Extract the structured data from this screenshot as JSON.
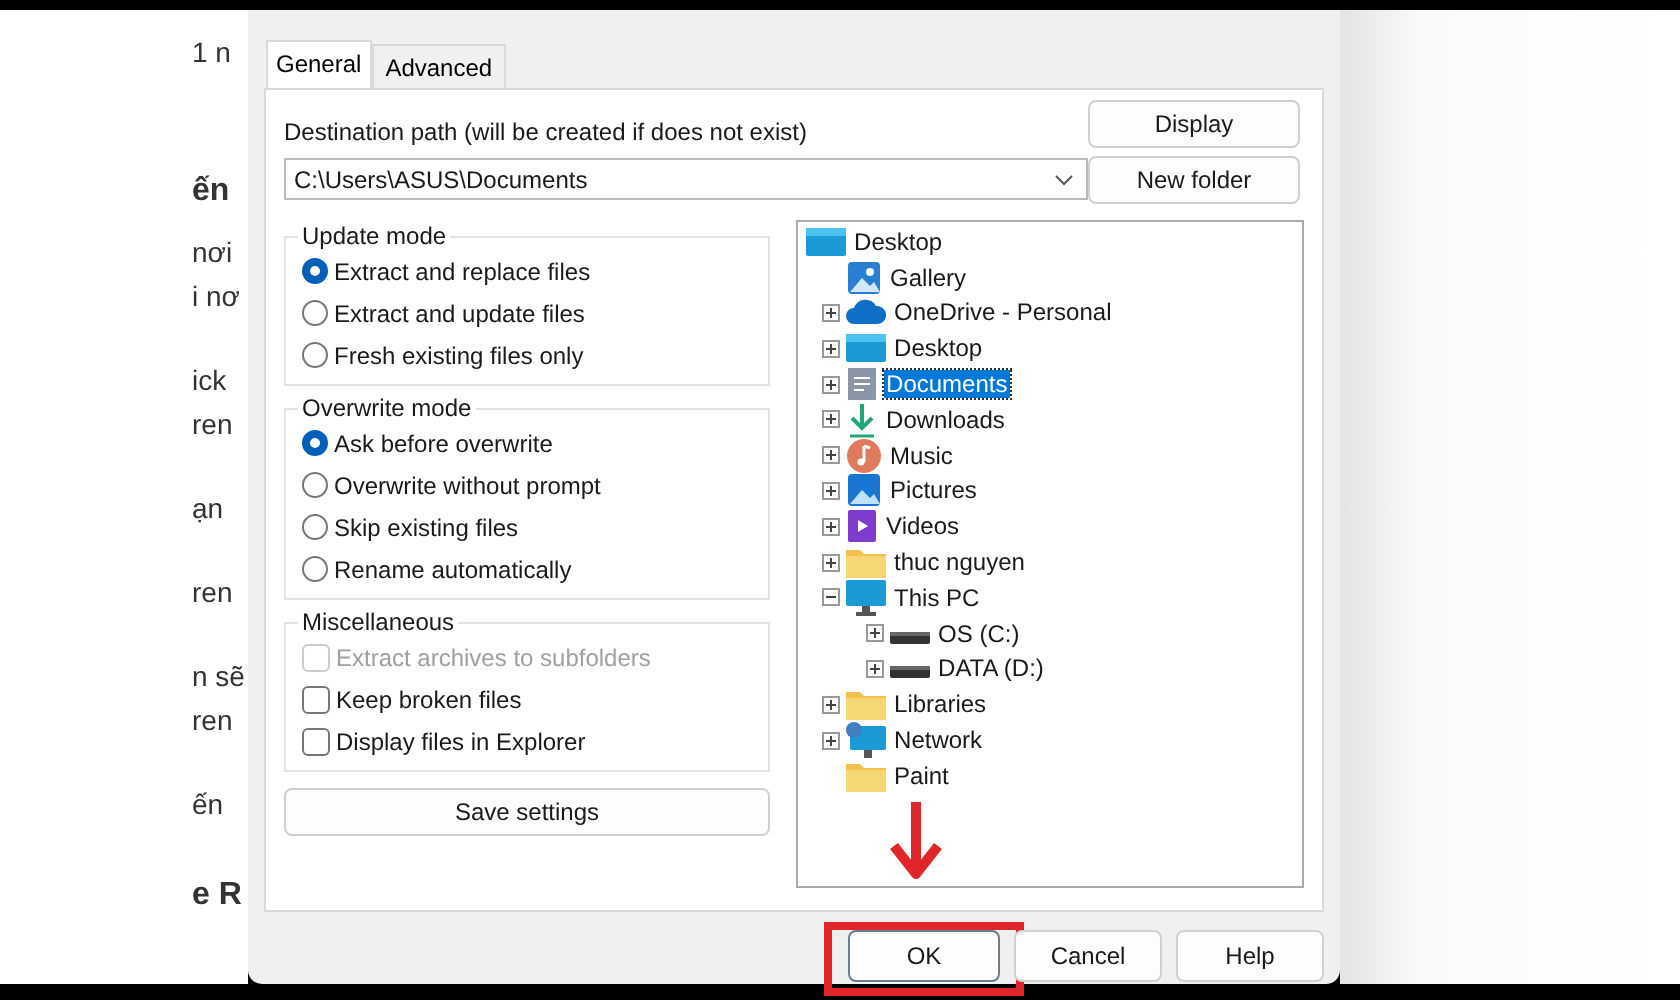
{
  "background_page": {
    "lines": [
      {
        "text": "1 n",
        "kind": "body"
      },
      {
        "text": "ến",
        "kind": "heading"
      },
      {
        "text": "nơi",
        "kind": "body"
      },
      {
        "text": "i nơ",
        "kind": "body"
      },
      {
        "text": "ick",
        "kind": "body"
      },
      {
        "text": "ren",
        "kind": "body"
      },
      {
        "text": "ạn",
        "kind": "body"
      },
      {
        "text": "ren",
        "kind": "body"
      },
      {
        "text": "n sẽ",
        "kind": "body"
      },
      {
        "text": "ren",
        "kind": "body"
      },
      {
        "text": "ến",
        "kind": "body"
      },
      {
        "text": "e R",
        "kind": "heading"
      }
    ]
  },
  "dialog": {
    "tabs": [
      {
        "label": "General",
        "selected": true
      },
      {
        "label": "Advanced",
        "selected": false
      }
    ],
    "destination": {
      "label": "Destination path (will be created if does not exist)",
      "value": "C:\\Users\\ASUS\\Documents"
    },
    "side_buttons": [
      "Display",
      "New folder"
    ],
    "update_mode": {
      "title": "Update mode",
      "options": [
        {
          "label": "Extract and replace files",
          "selected": true
        },
        {
          "label": "Extract and update files",
          "selected": false
        },
        {
          "label": "Fresh existing files only",
          "selected": false
        }
      ]
    },
    "overwrite_mode": {
      "title": "Overwrite mode",
      "options": [
        {
          "label": "Ask before overwrite",
          "selected": true
        },
        {
          "label": "Overwrite without prompt",
          "selected": false
        },
        {
          "label": "Skip existing files",
          "selected": false
        },
        {
          "label": "Rename automatically",
          "selected": false
        }
      ]
    },
    "miscellaneous": {
      "title": "Miscellaneous",
      "options": [
        {
          "label": "Extract archives to subfolders",
          "checked": false,
          "disabled": true
        },
        {
          "label": "Keep broken files",
          "checked": false,
          "disabled": false
        },
        {
          "label": "Display files in Explorer",
          "checked": false,
          "disabled": false
        }
      ]
    },
    "save_button": "Save settings",
    "tree": [
      {
        "label": "Desktop",
        "kind": "desktop",
        "selected": false,
        "children": [
          {
            "label": "Gallery",
            "kind": "gallery",
            "selected": false
          },
          {
            "label": "OneDrive - Personal",
            "kind": "cloud",
            "selected": false,
            "expanded": false
          },
          {
            "label": "Desktop",
            "kind": "desktop",
            "selected": false,
            "expanded": false
          },
          {
            "label": "Documents",
            "kind": "document",
            "selected": true,
            "expanded": false
          },
          {
            "label": "Downloads",
            "kind": "download",
            "selected": false,
            "expanded": false
          },
          {
            "label": "Music",
            "kind": "music",
            "selected": false,
            "expanded": false
          },
          {
            "label": "Pictures",
            "kind": "pictures",
            "selected": false,
            "expanded": false
          },
          {
            "label": "Videos",
            "kind": "videos",
            "selected": false,
            "expanded": false
          },
          {
            "label": "thuc nguyen",
            "kind": "folder",
            "selected": false,
            "expanded": false
          },
          {
            "label": "This PC",
            "kind": "pc",
            "selected": false,
            "expanded": true,
            "children": [
              {
                "label": "OS (C:)",
                "kind": "drive",
                "selected": false,
                "expanded": false
              },
              {
                "label": "DATA (D:)",
                "kind": "drive",
                "selected": false,
                "expanded": false
              }
            ]
          },
          {
            "label": "Libraries",
            "kind": "folder",
            "selected": false,
            "expanded": false
          },
          {
            "label": "Network",
            "kind": "network",
            "selected": false,
            "expanded": false
          },
          {
            "label": "Paint",
            "kind": "folder",
            "selected": false
          }
        ]
      }
    ],
    "buttons": [
      {
        "label": "OK",
        "highlighted": true
      },
      {
        "label": "Cancel",
        "highlighted": false
      },
      {
        "label": "Help",
        "highlighted": false
      }
    ],
    "annotation_arrow": true
  }
}
